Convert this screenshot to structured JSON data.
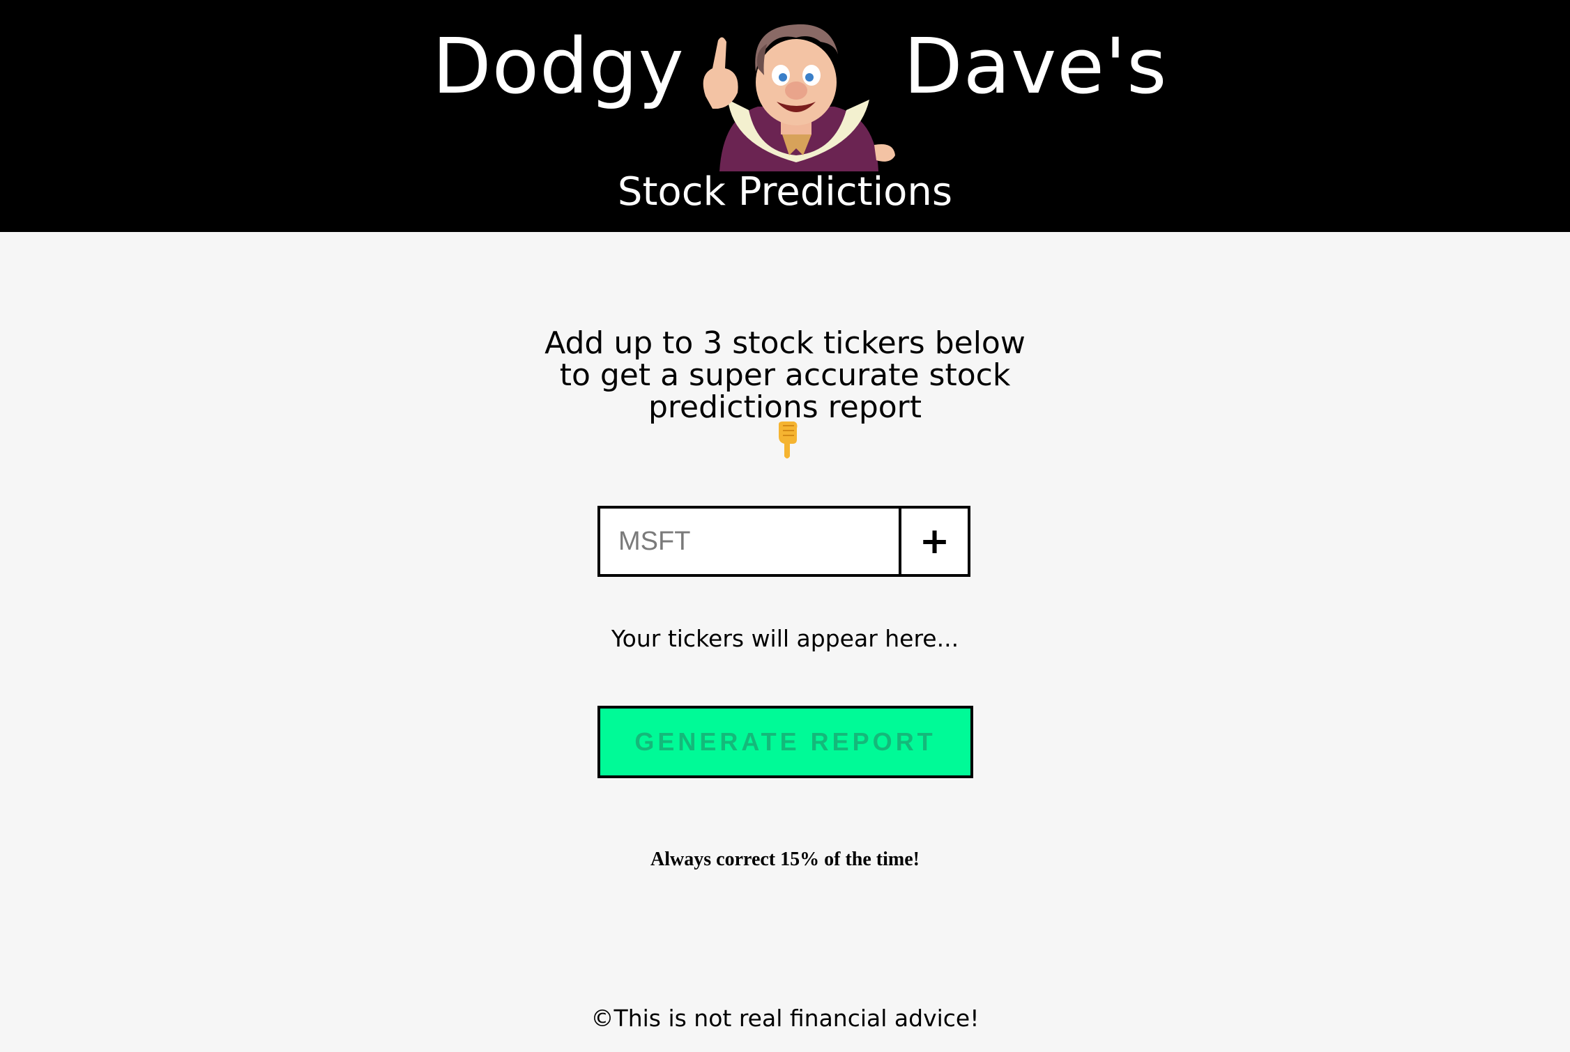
{
  "header": {
    "logo_left": "Dodgy",
    "logo_right": "Dave's",
    "logo_subtitle": "Stock Predictions",
    "mascot_icon": "cartoon-man-pointing-icon"
  },
  "main": {
    "intro_text": "Add up to 3 stock tickers below to get a super accurate stock predictions report",
    "pointer_icon": "pointing-down-hand-icon",
    "ticker_input": {
      "placeholder": "MSFT",
      "value": ""
    },
    "add_button_label": "+",
    "tickers_placeholder": "Your tickers will appear here...",
    "generate_button_label": "GENERATE REPORT",
    "tagline": "Always correct 15% of the time!"
  },
  "footer": {
    "text": "©This is not real financial advice!"
  },
  "colors": {
    "header_bg": "#000000",
    "page_bg": "#f6f6f6",
    "generate_bg": "#00fa97",
    "generate_text": "#14b97a"
  }
}
